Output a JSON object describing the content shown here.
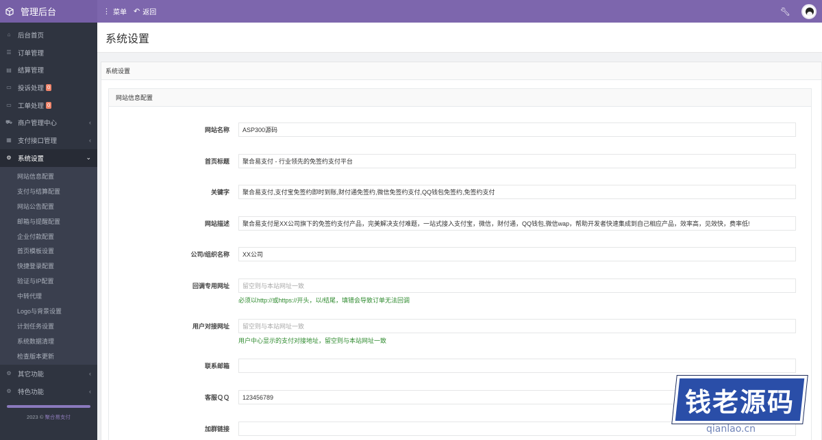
{
  "app": {
    "title": "管理后台"
  },
  "topnav": {
    "menu_label": "菜单",
    "back_label": "返回"
  },
  "sidebar": {
    "items": [
      {
        "label": "后台首页"
      },
      {
        "label": "订单管理"
      },
      {
        "label": "结算管理"
      },
      {
        "label": "投诉处理",
        "badge": "0"
      },
      {
        "label": "工单处理",
        "badge": "0"
      },
      {
        "label": "商户管理中心"
      },
      {
        "label": "支付接口管理"
      },
      {
        "label": "系统设置"
      },
      {
        "label": "其它功能"
      },
      {
        "label": "特色功能"
      }
    ],
    "submenu": [
      "网站信息配置",
      "支付与结算配置",
      "网站公告配置",
      "邮箱与提醒配置",
      "企业付款配置",
      "首页模板设置",
      "快捷登录配置",
      "验证与IP配置",
      "中转代理",
      "Logo与背景设置",
      "计划任务设置",
      "系统数据清理",
      "检查版本更新"
    ],
    "footer": {
      "year": "2023 ©",
      "link": "聚合易支付"
    }
  },
  "page": {
    "title": "系统设置"
  },
  "panel": {
    "title": "系统设置",
    "inner_title": "网站信息配置"
  },
  "form": {
    "site_name": {
      "label": "网站名称",
      "value": "ASP300源码"
    },
    "home_title": {
      "label": "首页标题",
      "value": "聚合易支付 - 行业领先的免签约支付平台"
    },
    "keywords": {
      "label": "关键字",
      "value": "聚合易支付,支付宝免签约即时到账,财付通免签约,微信免签约支付,QQ钱包免签约,免签约支付"
    },
    "description": {
      "label": "网站描述",
      "value": "聚合易支付是XX公司旗下的免签约支付产品，完美解决支付难题，一站式接入支付宝，微信，财付通，QQ钱包,微信wap，帮助开发者快速集成到自己相应产品，效率高，见效快，费率低!"
    },
    "company": {
      "label": "公司/组织名称",
      "value": "XX公司"
    },
    "callback_url": {
      "label": "回调专用网址",
      "placeholder": "留空则与本站网址一致",
      "help": "必须以http://或https://开头，以/结尾，填错会导致订单无法回调"
    },
    "user_api_url": {
      "label": "用户对接网址",
      "placeholder": "留空则与本站网址一致",
      "help": "用户中心显示的支付对接地址，留空则与本站网址一致"
    },
    "email": {
      "label": "联系邮箱",
      "value": ""
    },
    "qq": {
      "label": "客服ＱＱ",
      "value": "123456789"
    },
    "group_link": {
      "label": "加群链接",
      "value": ""
    }
  },
  "watermark": {
    "text": "钱老源码",
    "url": "qianlao.cn"
  }
}
